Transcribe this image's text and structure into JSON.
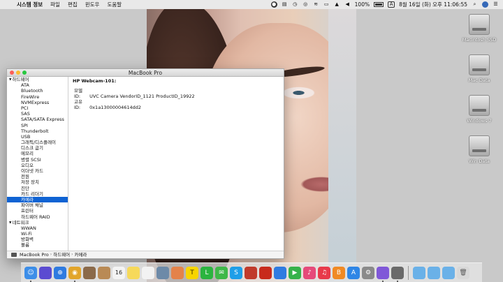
{
  "menubar": {
    "app_name": "시스템 정보",
    "items": [
      "파일",
      "편집",
      "윈도우",
      "도움말"
    ],
    "battery": "100%",
    "input_source": "A",
    "clock": "8월 16일 (화) 오후 11:06:55"
  },
  "desktop": {
    "drives": [
      "Macintosh SSD",
      "Mac Data",
      "Windows 7",
      "Win Data"
    ]
  },
  "window": {
    "title": "MacBook Pro",
    "sidebar": [
      {
        "label": "하드웨어",
        "group": true
      },
      {
        "label": "ATA"
      },
      {
        "label": "Bluetooth"
      },
      {
        "label": "FireWire"
      },
      {
        "label": "NVMExpress"
      },
      {
        "label": "PCI"
      },
      {
        "label": "SAS"
      },
      {
        "label": "SATA/SATA Express"
      },
      {
        "label": "SPI"
      },
      {
        "label": "Thunderbolt"
      },
      {
        "label": "USB"
      },
      {
        "label": "그래픽/디스플레이"
      },
      {
        "label": "디스크 굽기"
      },
      {
        "label": "메모리"
      },
      {
        "label": "병렬 SCSI"
      },
      {
        "label": "오디오"
      },
      {
        "label": "이더넷 카드"
      },
      {
        "label": "전원"
      },
      {
        "label": "저장 장치"
      },
      {
        "label": "진단"
      },
      {
        "label": "카드 리더기"
      },
      {
        "label": "카메라",
        "selected": true
      },
      {
        "label": "파이버 채널"
      },
      {
        "label": "프린터"
      },
      {
        "label": "하드웨어 RAID"
      },
      {
        "label": "네트워크",
        "group": true
      },
      {
        "label": "WWAN"
      },
      {
        "label": "Wi-Fi"
      },
      {
        "label": "방화벽"
      },
      {
        "label": "볼륨"
      }
    ],
    "content": {
      "heading": "HP Webcam-101:",
      "rows": [
        {
          "key": "모델 ID:",
          "value": "UVC Camera VendorID_1121 ProductID_19922"
        },
        {
          "key": "고유 ID:",
          "value": "0x1a13000004614dd2"
        }
      ]
    },
    "path": [
      "MacBook Pro",
      "하드웨어",
      "카메라"
    ]
  },
  "dock": {
    "apps": [
      {
        "name": "finder-icon",
        "color": "#3d8ee8"
      },
      {
        "name": "siri-icon",
        "color": "#5b4bd1"
      },
      {
        "name": "safari-icon",
        "color": "#2f7be0"
      },
      {
        "name": "chrome-icon",
        "color": "#e2a52a"
      },
      {
        "name": "photos-icon",
        "color": "#8b6a4a"
      },
      {
        "name": "contacts-icon",
        "color": "#b98a55"
      },
      {
        "name": "calendar-icon",
        "color": "#f4f4f4"
      },
      {
        "name": "notes-icon",
        "color": "#f6d95a"
      },
      {
        "name": "reminders-icon",
        "color": "#f2f2f2"
      },
      {
        "name": "preview-icon",
        "color": "#6d8aa8"
      },
      {
        "name": "photos-app-icon",
        "color": "#e4824a"
      },
      {
        "name": "kakaotalk-icon",
        "color": "#f7d400"
      },
      {
        "name": "line-icon",
        "color": "#2bb43f"
      },
      {
        "name": "messages-icon",
        "color": "#3fb848"
      },
      {
        "name": "skype-icon",
        "color": "#1e9ee8"
      },
      {
        "name": "photo-booth-icon",
        "color": "#c03a2b"
      },
      {
        "name": "game-icon",
        "color": "#c82a1c"
      },
      {
        "name": "dots-icon",
        "color": "#2f7be0"
      },
      {
        "name": "facetime-icon",
        "color": "#36b24a"
      },
      {
        "name": "itunes-icon",
        "color": "#e64a7a"
      },
      {
        "name": "music-icon",
        "color": "#e83a4a"
      },
      {
        "name": "ibooks-icon",
        "color": "#f08a24"
      },
      {
        "name": "app-store-icon",
        "color": "#2e86e6"
      },
      {
        "name": "system-preferences-icon",
        "color": "#8a8a8a"
      },
      {
        "name": "scroll-icon",
        "color": "#8058d8"
      },
      {
        "name": "system-info-icon",
        "color": "#6a6a6a"
      }
    ],
    "folders": [
      {
        "name": "applications-folder-icon",
        "color": "#6ab1e8"
      },
      {
        "name": "documents-folder-icon",
        "color": "#6ab1e8"
      },
      {
        "name": "downloads-folder-icon",
        "color": "#6ab1e8"
      },
      {
        "name": "trash-icon",
        "color": "#d8d8d8"
      }
    ]
  }
}
